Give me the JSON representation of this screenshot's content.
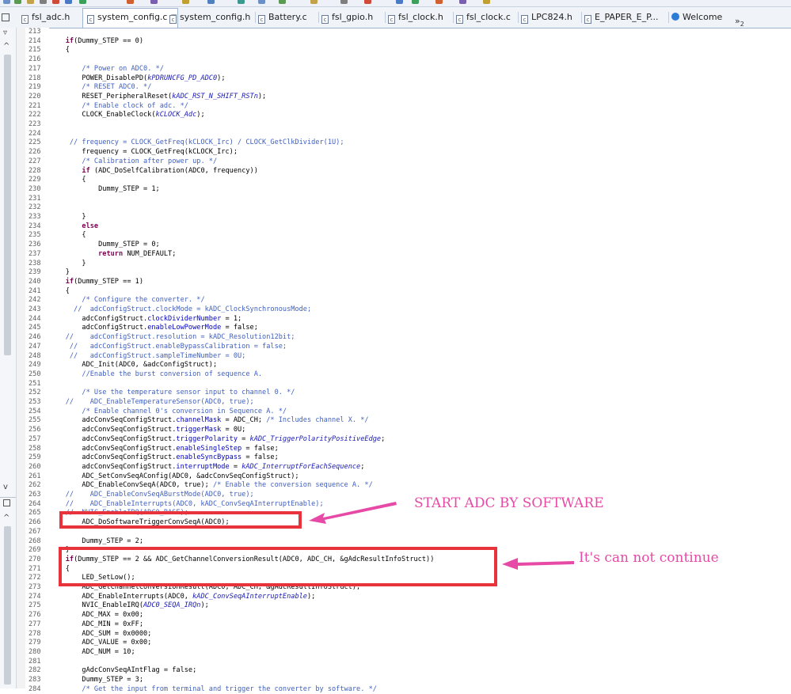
{
  "tabs": [
    {
      "label": "fsl_adc.h",
      "active": false
    },
    {
      "label": "system_config.c",
      "active": true
    },
    {
      "label": "system_config.h",
      "active": false
    },
    {
      "label": "Battery.c",
      "active": false
    },
    {
      "label": "fsl_gpio.h",
      "active": false
    },
    {
      "label": "fsl_clock.h",
      "active": false
    },
    {
      "label": "fsl_clock.c",
      "active": false
    },
    {
      "label": "LPC824.h",
      "active": false
    },
    {
      "label": "E_PAPER_E_P...",
      "active": false
    },
    {
      "label": "Welcome",
      "active": false
    }
  ],
  "tab_close_glyph": "⊠",
  "overflow": {
    "chevron": "»",
    "count": "2"
  },
  "colors": {
    "keyword": "#7f0055",
    "comment": "#3f5fbf",
    "constant": "#1a1ab3",
    "field": "#0000c0",
    "highlight_box": "#e8323c",
    "annotation": "#e64aa6"
  },
  "editor": {
    "lines": [
      {
        "n": "213",
        "t": ""
      },
      {
        "n": "214",
        "t": "    if(Dummy_STEP == 0)"
      },
      {
        "n": "215",
        "t": "    {"
      },
      {
        "n": "216",
        "t": ""
      },
      {
        "n": "217",
        "t": "        /* Power on ADC0. */"
      },
      {
        "n": "218",
        "t": "        POWER_DisablePD(kPDRUNCFG_PD_ADC0);"
      },
      {
        "n": "219",
        "t": "        /* RESET ADC0. */"
      },
      {
        "n": "220",
        "t": "        RESET_PeripheralReset(kADC_RST_N_SHIFT_RSTn);"
      },
      {
        "n": "221",
        "t": "        /* Enable clock of adc. */"
      },
      {
        "n": "222",
        "t": "        CLOCK_EnableClock(kCLOCK_Adc);"
      },
      {
        "n": "223",
        "t": ""
      },
      {
        "n": "224",
        "t": ""
      },
      {
        "n": "225",
        "t": "     // frequency = CLOCK_GetFreq(kCLOCK_Irc) / CLOCK_GetClkDivider(1U);"
      },
      {
        "n": "226",
        "t": "        frequency = CLOCK_GetFreq(kCLOCK_Irc);"
      },
      {
        "n": "227",
        "t": "        /* Calibration after power up. */"
      },
      {
        "n": "228",
        "t": "        if (ADC_DoSelfCalibration(ADC0, frequency))"
      },
      {
        "n": "229",
        "t": "        {"
      },
      {
        "n": "230",
        "t": "            Dummy_STEP = 1;"
      },
      {
        "n": "231",
        "t": ""
      },
      {
        "n": "232",
        "t": ""
      },
      {
        "n": "233",
        "t": "        }"
      },
      {
        "n": "234",
        "t": "        else"
      },
      {
        "n": "235",
        "t": "        {"
      },
      {
        "n": "236",
        "t": "            Dummy_STEP = 0;"
      },
      {
        "n": "237",
        "t": "            return NUM_DEFAULT;"
      },
      {
        "n": "238",
        "t": "        }"
      },
      {
        "n": "239",
        "t": "    }"
      },
      {
        "n": "240",
        "t": "    if(Dummy_STEP == 1)"
      },
      {
        "n": "241",
        "t": "    {"
      },
      {
        "n": "242",
        "t": "        /* Configure the converter. */"
      },
      {
        "n": "243",
        "t": "      //  adcConfigStruct.clockMode = kADC_ClockSynchronousMode;"
      },
      {
        "n": "244",
        "t": "        adcConfigStruct.clockDividerNumber = 1;"
      },
      {
        "n": "245",
        "t": "        adcConfigStruct.enableLowPowerMode = false;"
      },
      {
        "n": "246",
        "t": "    //    adcConfigStruct.resolution = kADC_Resolution12bit;"
      },
      {
        "n": "247",
        "t": "     //   adcConfigStruct.enableBypassCalibration = false;"
      },
      {
        "n": "248",
        "t": "     //   adcConfigStruct.sampleTimeNumber = 0U;"
      },
      {
        "n": "249",
        "t": "        ADC_Init(ADC0, &adcConfigStruct);"
      },
      {
        "n": "250",
        "t": "        //Enable the burst conversion of sequence A."
      },
      {
        "n": "251",
        "t": ""
      },
      {
        "n": "252",
        "t": "        /* Use the temperature sensor input to channel 0. */"
      },
      {
        "n": "253",
        "t": "    //    ADC_EnableTemperatureSensor(ADC0, true);"
      },
      {
        "n": "254",
        "t": "        /* Enable channel 0's conversion in Sequence A. */"
      },
      {
        "n": "255",
        "t": "        adcConvSeqConfigStruct.channelMask = ADC_CH; /* Includes channel X. */"
      },
      {
        "n": "256",
        "t": "        adcConvSeqConfigStruct.triggerMask = 0U;"
      },
      {
        "n": "257",
        "t": "        adcConvSeqConfigStruct.triggerPolarity = kADC_TriggerPolarityPositiveEdge;"
      },
      {
        "n": "258",
        "t": "        adcConvSeqConfigStruct.enableSingleStep = false;"
      },
      {
        "n": "259",
        "t": "        adcConvSeqConfigStruct.enableSyncBypass = false;"
      },
      {
        "n": "260",
        "t": "        adcConvSeqConfigStruct.interruptMode = kADC_InterruptForEachSequence;"
      },
      {
        "n": "261",
        "t": "        ADC_SetConvSeqAConfig(ADC0, &adcConvSeqConfigStruct);"
      },
      {
        "n": "262",
        "t": "        ADC_EnableConvSeqA(ADC0, true); /* Enable the conversion sequence A. */"
      },
      {
        "n": "263",
        "t": "    //    ADC_EnableConvSeqABurstMode(ADC0, true);"
      },
      {
        "n": "264",
        "t": "    //    ADC_EnableInterrupts(ADC0, kADC_ConvSeqAInterruptEnable);"
      },
      {
        "n": "265",
        "t": "    //  NVIC_EnableIRQ(ADC0_BASE);"
      },
      {
        "n": "266",
        "t": "        ADC_DoSoftwareTriggerConvSeqA(ADC0);"
      },
      {
        "n": "267",
        "t": ""
      },
      {
        "n": "268",
        "t": "        Dummy_STEP = 2;"
      },
      {
        "n": "269",
        "t": "    }"
      },
      {
        "n": "270",
        "t": "    if(Dummy_STEP == 2 && ADC_GetChannelConversionResult(ADC0, ADC_CH, &gAdcResultInfoStruct))"
      },
      {
        "n": "271",
        "t": "    {"
      },
      {
        "n": "272",
        "t": "        LED_SetLow();"
      },
      {
        "n": "273",
        "t": "        ADC_GetChannelConversionResult(ADC0, ADC_CH, &gAdcResultInfoStruct);"
      },
      {
        "n": "274",
        "t": "        ADC_EnableInterrupts(ADC0, kADC_ConvSeqAInterruptEnable);"
      },
      {
        "n": "275",
        "t": "        NVIC_EnableIRQ(ADC0_SEQA_IRQn);"
      },
      {
        "n": "276",
        "t": "        ADC_MAX = 0x00;"
      },
      {
        "n": "277",
        "t": "        ADC_MIN = 0xFF;"
      },
      {
        "n": "278",
        "t": "        ADC_SUM = 0x0000;"
      },
      {
        "n": "279",
        "t": "        ADC_VALUE = 0x00;"
      },
      {
        "n": "280",
        "t": "        ADC_NUM = 10;"
      },
      {
        "n": "281",
        "t": ""
      },
      {
        "n": "282",
        "t": "        gAdcConvSeqAIntFlag = false;"
      },
      {
        "n": "283",
        "t": "        Dummy_STEP = 3;"
      },
      {
        "n": "284",
        "t": "        /* Get the input from terminal and trigger the converter by software. */"
      }
    ]
  },
  "annotations": {
    "start": "START ADC BY SOFTWARE",
    "stuck": "It's can not continue"
  }
}
